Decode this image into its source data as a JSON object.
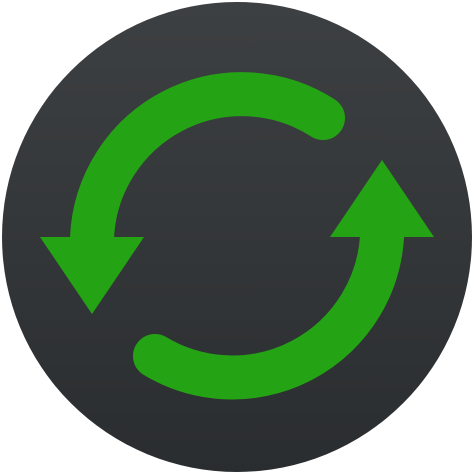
{
  "icon": {
    "name": "refresh-sync-icon",
    "colors": {
      "background_top": "#3d4042",
      "background_bottom": "#2a2d2f",
      "arrow_top": "#7be04a",
      "arrow_bottom": "#24a414"
    }
  }
}
